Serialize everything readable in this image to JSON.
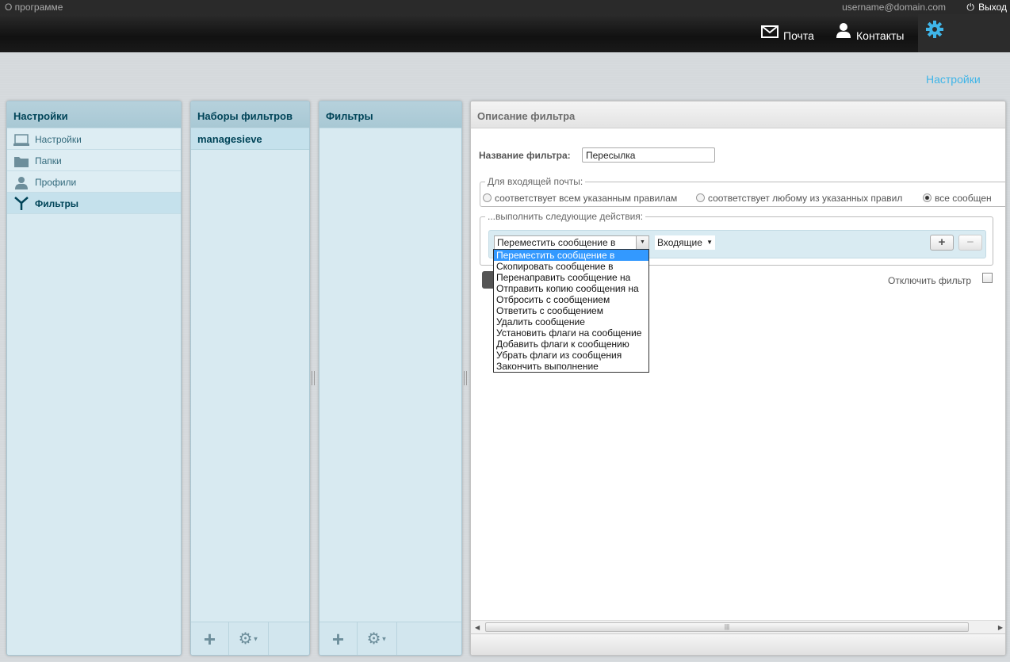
{
  "topbar": {
    "about": "О программе",
    "username": "username@domain.com",
    "logout": "Выход"
  },
  "nav": {
    "mail": "Почта",
    "contacts": "Контакты",
    "settings": "Настройки",
    "active_color": "#3fb5e8"
  },
  "settings_panel": {
    "title": "Настройки",
    "items": [
      {
        "label": "Настройки",
        "icon": "laptop-icon"
      },
      {
        "label": "Папки",
        "icon": "folder-icon"
      },
      {
        "label": "Профили",
        "icon": "person-icon"
      },
      {
        "label": "Фильтры",
        "icon": "filter-icon",
        "selected": true
      }
    ]
  },
  "filter_sets_panel": {
    "title": "Наборы фильтров",
    "items": [
      "managesieve"
    ]
  },
  "filters_panel": {
    "title": "Фильтры"
  },
  "desc_panel": {
    "title": "Описание фильтра",
    "name_label": "Название фильтра:",
    "name_value": "Пересылка",
    "incoming_legend": "Для входящей почты:",
    "rules": [
      {
        "label": "соответствует всем указанным правилам",
        "checked": false
      },
      {
        "label": "соответствует любому из указанных правил",
        "checked": false
      },
      {
        "label": "все сообщен",
        "checked": true
      }
    ],
    "actions_legend": "...выполнить следующие действия:",
    "action_select": "Переместить сообщение в",
    "folder_select": "Входящие",
    "plus": "+",
    "minus": "−",
    "disable_label": "Отключить фильтр",
    "action_options": [
      "Переместить сообщение в",
      "Скопировать сообщение в",
      "Перенаправить сообщение на",
      "Отправить копию сообщения на",
      "Отбросить с сообщением",
      "Ответить с сообщением",
      "Удалить сообщение",
      "Установить флаги на сообщение",
      "Добавить флаги к сообщению",
      "Убрать флаги из сообщения",
      "Закончить выполнение"
    ],
    "highlighted_option": 0
  }
}
